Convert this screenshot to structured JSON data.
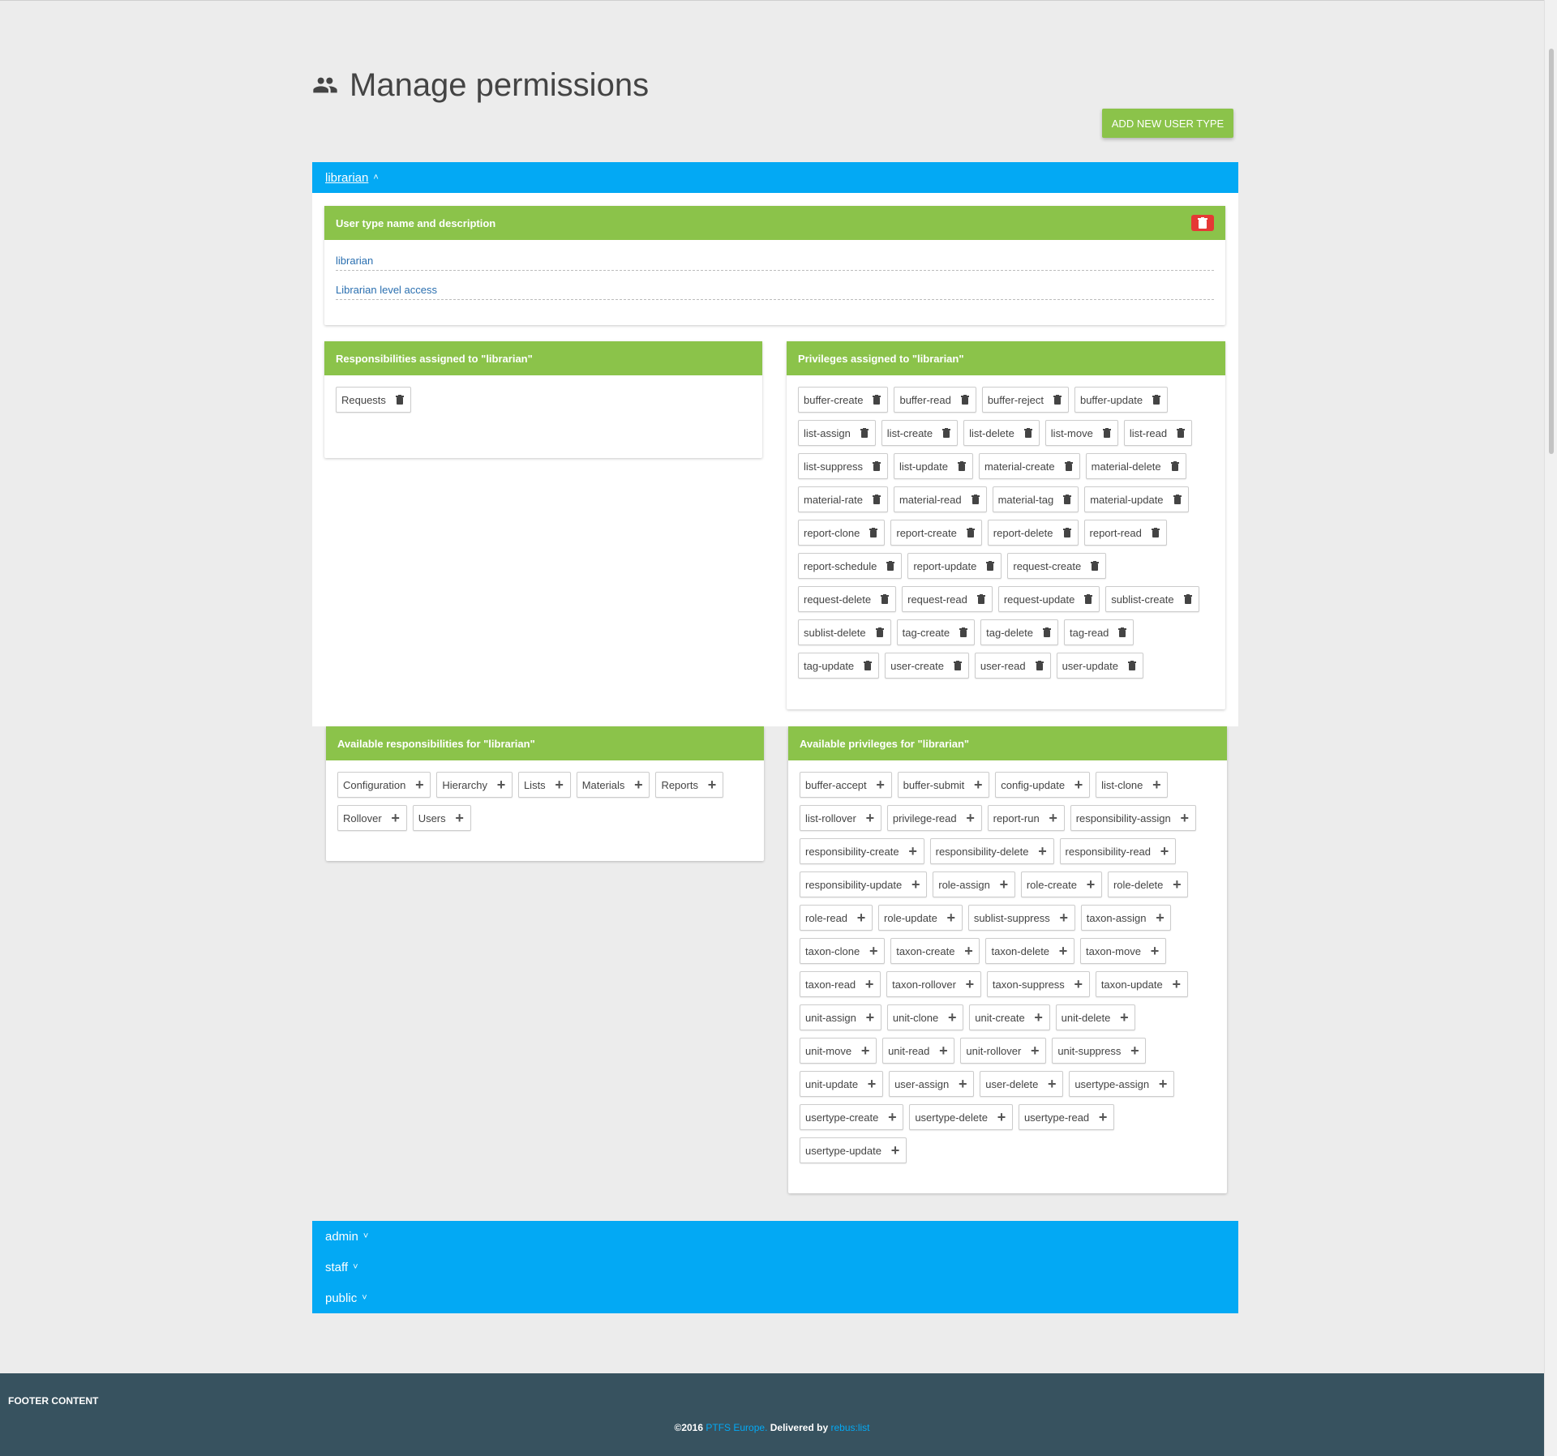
{
  "page": {
    "title": "Manage permissions",
    "title_icon": "group-icon",
    "add_button_label": "ADD NEW USER TYPE"
  },
  "colors": {
    "accent_blue": "#03a9f4",
    "panel_green": "#8bc34a",
    "delete_red": "#e53935",
    "footer_bg": "#37525f"
  },
  "user_types": [
    {
      "label": "librarian",
      "expanded": true
    },
    {
      "label": "admin",
      "expanded": false
    },
    {
      "label": "staff",
      "expanded": false
    },
    {
      "label": "public",
      "expanded": false
    }
  ],
  "librarian": {
    "name_panel": {
      "title": "User type name and description",
      "name": "librarian",
      "description": "Librarian level access"
    },
    "responsibilities_assigned": {
      "title": "Responsibilities assigned to \"librarian\"",
      "items": [
        "Requests"
      ]
    },
    "privileges_assigned": {
      "title": "Privileges assigned to \"librarian\"",
      "items": [
        "buffer-create",
        "buffer-read",
        "buffer-reject",
        "buffer-update",
        "list-assign",
        "list-create",
        "list-delete",
        "list-move",
        "list-read",
        "list-suppress",
        "list-update",
        "material-create",
        "material-delete",
        "material-rate",
        "material-read",
        "material-tag",
        "material-update",
        "report-clone",
        "report-create",
        "report-delete",
        "report-read",
        "report-schedule",
        "report-update",
        "request-create",
        "request-delete",
        "request-read",
        "request-update",
        "sublist-create",
        "sublist-delete",
        "tag-create",
        "tag-delete",
        "tag-read",
        "tag-update",
        "user-create",
        "user-read",
        "user-update"
      ]
    },
    "responsibilities_available": {
      "title": "Available responsibilities for \"librarian\"",
      "items": [
        "Configuration",
        "Hierarchy",
        "Lists",
        "Materials",
        "Reports",
        "Rollover",
        "Users"
      ]
    },
    "privileges_available": {
      "title": "Available privileges for \"librarian\"",
      "items": [
        "buffer-accept",
        "buffer-submit",
        "config-update",
        "list-clone",
        "list-rollover",
        "privilege-read",
        "report-run",
        "responsibility-assign",
        "responsibility-create",
        "responsibility-delete",
        "responsibility-read",
        "responsibility-update",
        "role-assign",
        "role-create",
        "role-delete",
        "role-read",
        "role-update",
        "sublist-suppress",
        "taxon-assign",
        "taxon-clone",
        "taxon-create",
        "taxon-delete",
        "taxon-move",
        "taxon-read",
        "taxon-rollover",
        "taxon-suppress",
        "taxon-update",
        "unit-assign",
        "unit-clone",
        "unit-create",
        "unit-delete",
        "unit-move",
        "unit-read",
        "unit-rollover",
        "unit-suppress",
        "unit-update",
        "user-assign",
        "user-delete",
        "usertype-assign",
        "usertype-create",
        "usertype-delete",
        "usertype-read",
        "usertype-update"
      ]
    }
  },
  "footer": {
    "content_label": "FOOTER CONTENT",
    "copyright": "©2016",
    "company": "PTFS Europe.",
    "delivered_by": "Delivered by",
    "product": "rebus:list"
  }
}
